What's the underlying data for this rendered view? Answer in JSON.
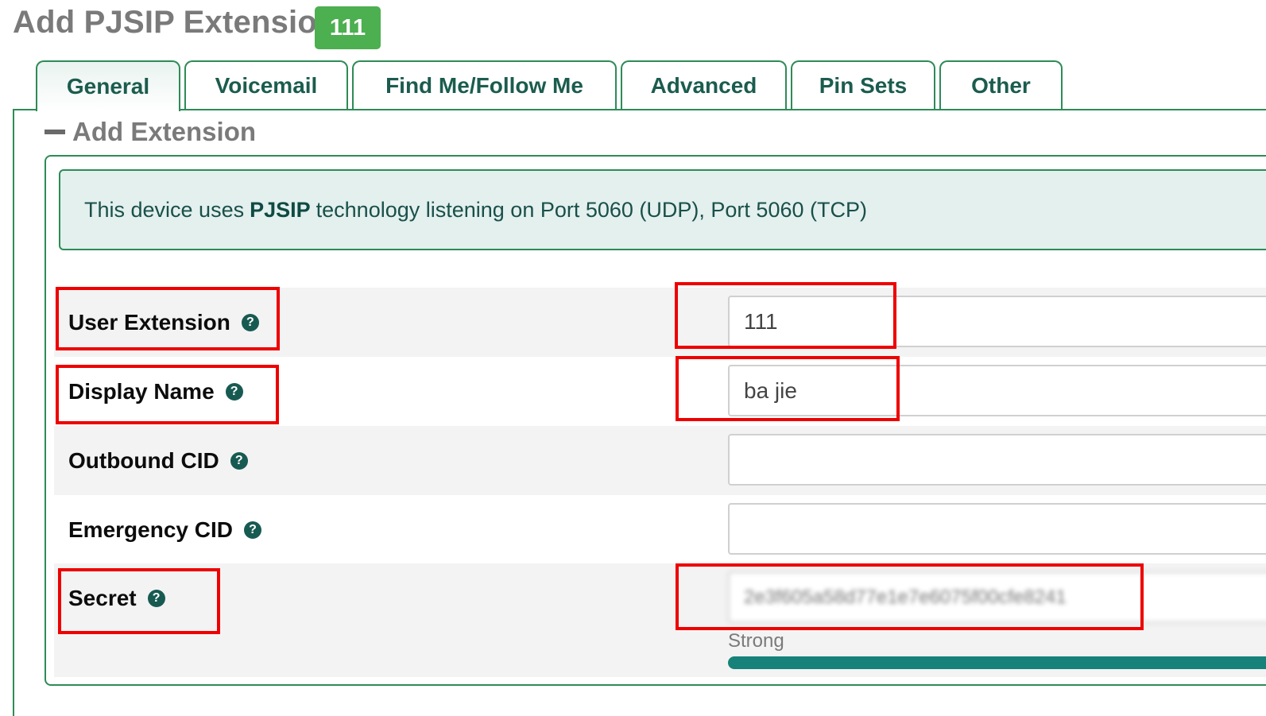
{
  "header": {
    "title": "Add PJSIP Extension",
    "extension_badge": "111"
  },
  "tabs": [
    {
      "label": "General",
      "active": true
    },
    {
      "label": "Voicemail",
      "active": false
    },
    {
      "label": "Find Me/Follow Me",
      "active": false
    },
    {
      "label": "Advanced",
      "active": false
    },
    {
      "label": "Pin Sets",
      "active": false
    },
    {
      "label": "Other",
      "active": false
    }
  ],
  "section": {
    "title": "Add Extension",
    "collapse_icon": "minus-icon"
  },
  "info": {
    "prefix": "This device uses",
    "tech": "PJSIP",
    "suffix": "technology listening on Port 5060 (UDP), Port 5060 (TCP)"
  },
  "fields": {
    "user_extension": {
      "label": "User Extension",
      "value": "111"
    },
    "display_name": {
      "label": "Display Name",
      "value": "ba jie"
    },
    "outbound_cid": {
      "label": "Outbound CID",
      "value": ""
    },
    "emergency_cid": {
      "label": "Emergency CID",
      "value": ""
    },
    "secret": {
      "label": "Secret",
      "value": "2e3f605a58d77e1e7e6075f00cfe8241"
    }
  },
  "help_icon": "?",
  "password_strength": {
    "label": "Strong",
    "level": 1.0
  },
  "colors": {
    "accent": "#2e8b57",
    "badge": "#4caf50",
    "highlight": "#ee0000",
    "strength_bar": "#17827a"
  }
}
